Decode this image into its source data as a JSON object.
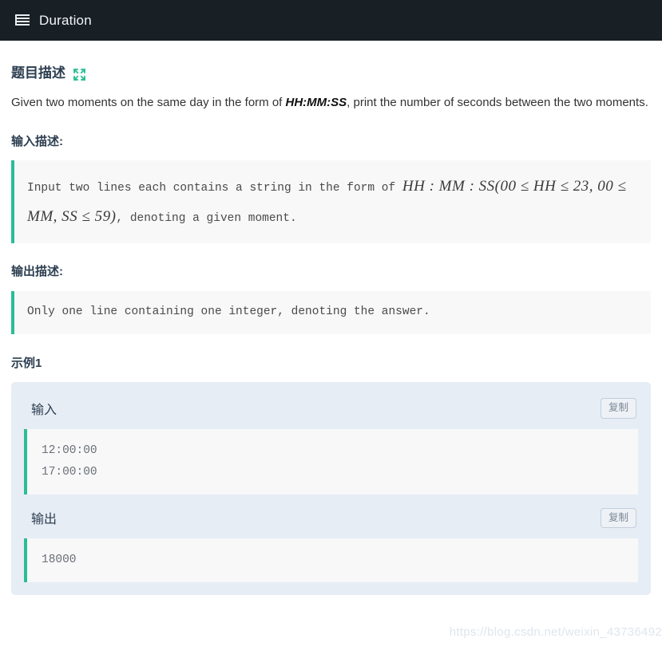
{
  "header": {
    "icon": "list-icon",
    "title": "Duration"
  },
  "problem": {
    "title": "题目描述",
    "expand_icon": "expand-arrows-icon",
    "description_before": "Given two moments on the same day in the form of ",
    "description_bold": "HH:MM:SS",
    "description_after": ", print the number of seconds between the two moments."
  },
  "input_section": {
    "title": "输入描述:",
    "text_1": "Input two lines each contains a string in the form of ",
    "math_1": "HH : MM : SS",
    "math_paren_open": "(",
    "math_2": "00 ≤ HH ≤ 23, 00 ≤ MM, SS ≤ 59",
    "math_paren_close": ")",
    "text_2": ", denoting a given moment."
  },
  "output_section": {
    "title": "输出描述:",
    "text": "Only one line containing one integer, denoting the answer."
  },
  "example": {
    "title": "示例1",
    "input_label": "输入",
    "input_copy_label": "复制",
    "input_code": "12:00:00\n17:00:00",
    "output_label": "输出",
    "output_copy_label": "复制",
    "output_code": "18000"
  },
  "watermark": {
    "text": "https://blog.csdn.net/weixin_43736492"
  },
  "colors": {
    "header_bg": "#181f25",
    "accent_green": "#2bbd96",
    "heading": "#2c3e50",
    "card_bg": "#e7edf5",
    "code_bg": "#f8f8f9"
  }
}
